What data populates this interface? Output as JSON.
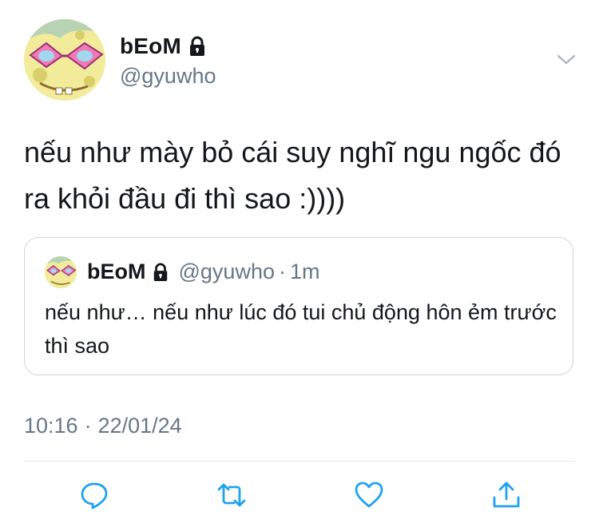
{
  "tweet": {
    "display_name": "bEoM",
    "handle": "@gyuwho",
    "text": "nếu như mày bỏ cái suy nghĩ ngu ngốc đó ra khỏi đầu đi thì sao :))))",
    "time": "10:16",
    "date": "22/01/24",
    "separator": "·"
  },
  "quoted": {
    "display_name": "bEoM",
    "handle": "@gyuwho",
    "separator": "·",
    "time_ago": "1m",
    "text": "nếu như… nếu như lúc đó tui chủ động hôn ẻm trước thì sao"
  },
  "icons": {
    "lock": "lock-icon",
    "menu": "chevron-down-icon",
    "reply": "reply-icon",
    "retweet": "retweet-icon",
    "like": "heart-icon",
    "share": "share-icon"
  },
  "colors": {
    "text": "#14171a",
    "muted": "#657786",
    "border": "#ccd6dd",
    "action": "#1da1f2"
  }
}
